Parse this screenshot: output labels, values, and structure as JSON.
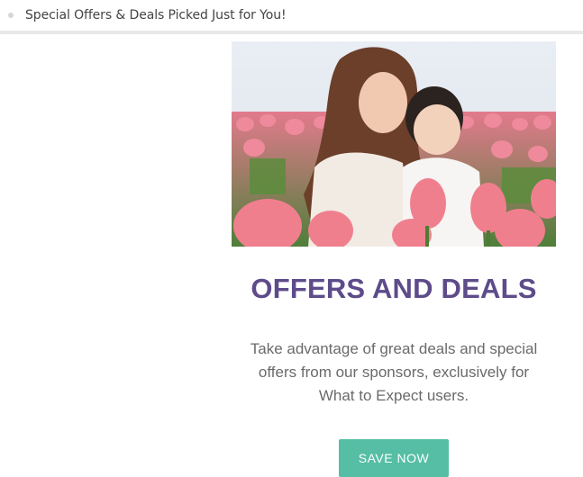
{
  "email": {
    "subject": "Special Offers & Deals Picked Just for You!"
  },
  "hero": {
    "image_name": "mother-and-baby-in-tulip-field"
  },
  "content": {
    "title": "OFFERS AND DEALS",
    "description_lines": [
      "Take advantage of great deals and special",
      "offers from our sponsors, exclusively for",
      "What to Expect users."
    ],
    "cta_label": "SAVE NOW"
  },
  "colors": {
    "title": "#5d4b8a",
    "body_text": "#6a6a6a",
    "button": "#55bea4",
    "button_text": "#ffffff"
  }
}
